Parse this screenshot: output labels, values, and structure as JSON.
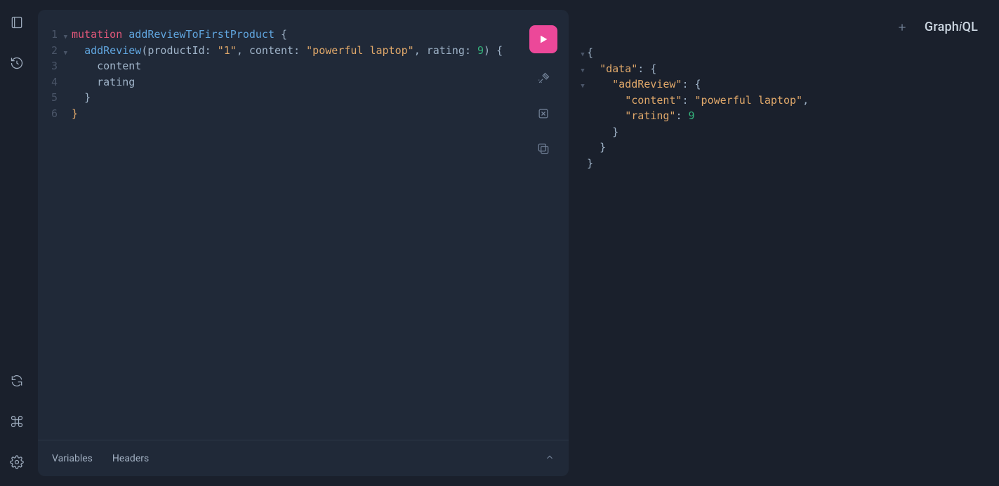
{
  "brand": {
    "pre": "Graph",
    "italic": "i",
    "post": "QL"
  },
  "sidebar": {
    "top": [
      {
        "name": "docs-icon"
      },
      {
        "name": "history-icon"
      }
    ],
    "bottom": [
      {
        "name": "refresh-icon"
      },
      {
        "name": "shortcuts-icon"
      },
      {
        "name": "settings-icon"
      }
    ]
  },
  "editor": {
    "lines": [
      {
        "n": "1",
        "fold": true,
        "tokens": [
          {
            "c": "tok-keyword",
            "t": "mutation"
          },
          {
            "c": "",
            "t": " "
          },
          {
            "c": "tok-name",
            "t": "addReviewToFirstProduct"
          },
          {
            "c": "",
            "t": " "
          },
          {
            "c": "tok-punct",
            "t": "{"
          }
        ]
      },
      {
        "n": "2",
        "fold": true,
        "tokens": [
          {
            "c": "",
            "t": "  "
          },
          {
            "c": "tok-field",
            "t": "addReview"
          },
          {
            "c": "tok-punct",
            "t": "("
          },
          {
            "c": "tok-arg",
            "t": "productId"
          },
          {
            "c": "tok-punct",
            "t": ": "
          },
          {
            "c": "tok-string",
            "t": "\"1\""
          },
          {
            "c": "tok-punct",
            "t": ", "
          },
          {
            "c": "tok-arg",
            "t": "content"
          },
          {
            "c": "tok-punct",
            "t": ": "
          },
          {
            "c": "tok-string",
            "t": "\"powerful laptop\""
          },
          {
            "c": "tok-punct",
            "t": ", "
          },
          {
            "c": "tok-arg",
            "t": "rating"
          },
          {
            "c": "tok-punct",
            "t": ": "
          },
          {
            "c": "tok-number",
            "t": "9"
          },
          {
            "c": "tok-punct",
            "t": ")"
          },
          {
            "c": "",
            "t": " "
          },
          {
            "c": "tok-punct",
            "t": "{"
          }
        ]
      },
      {
        "n": "3",
        "tokens": [
          {
            "c": "",
            "t": "    "
          },
          {
            "c": "tok-prop",
            "t": "content"
          }
        ]
      },
      {
        "n": "4",
        "tokens": [
          {
            "c": "",
            "t": "    "
          },
          {
            "c": "tok-prop",
            "t": "rating"
          }
        ]
      },
      {
        "n": "5",
        "tokens": [
          {
            "c": "",
            "t": "  "
          },
          {
            "c": "tok-punct",
            "t": "}"
          }
        ]
      },
      {
        "n": "6",
        "tokens": [
          {
            "c": "tok-brace-hl",
            "t": "}"
          }
        ]
      }
    ],
    "tools": [
      {
        "name": "prettify-icon"
      },
      {
        "name": "merge-icon"
      },
      {
        "name": "copy-icon"
      }
    ],
    "footer": {
      "tabs": [
        {
          "label": "Variables"
        },
        {
          "label": "Headers"
        }
      ]
    }
  },
  "response": {
    "lines": [
      {
        "fold": true,
        "tokens": [
          {
            "c": "pn",
            "t": "{"
          }
        ]
      },
      {
        "fold": true,
        "indent": "  ",
        "tokens": [
          {
            "c": "key",
            "t": "\"data\""
          },
          {
            "c": "pn",
            "t": ": {"
          }
        ]
      },
      {
        "fold": true,
        "indent": "    ",
        "tokens": [
          {
            "c": "key",
            "t": "\"addReview\""
          },
          {
            "c": "pn",
            "t": ": {"
          }
        ]
      },
      {
        "indent": "      ",
        "tokens": [
          {
            "c": "key",
            "t": "\"content\""
          },
          {
            "c": "pn",
            "t": ": "
          },
          {
            "c": "str",
            "t": "\"powerful laptop\""
          },
          {
            "c": "pn",
            "t": ","
          }
        ]
      },
      {
        "indent": "      ",
        "tokens": [
          {
            "c": "key",
            "t": "\"rating\""
          },
          {
            "c": "pn",
            "t": ": "
          },
          {
            "c": "num",
            "t": "9"
          }
        ]
      },
      {
        "indent": "    ",
        "tokens": [
          {
            "c": "pn",
            "t": "}"
          }
        ]
      },
      {
        "indent": "  ",
        "tokens": [
          {
            "c": "pn",
            "t": "}"
          }
        ]
      },
      {
        "tokens": [
          {
            "c": "pn",
            "t": "}"
          }
        ]
      }
    ]
  }
}
